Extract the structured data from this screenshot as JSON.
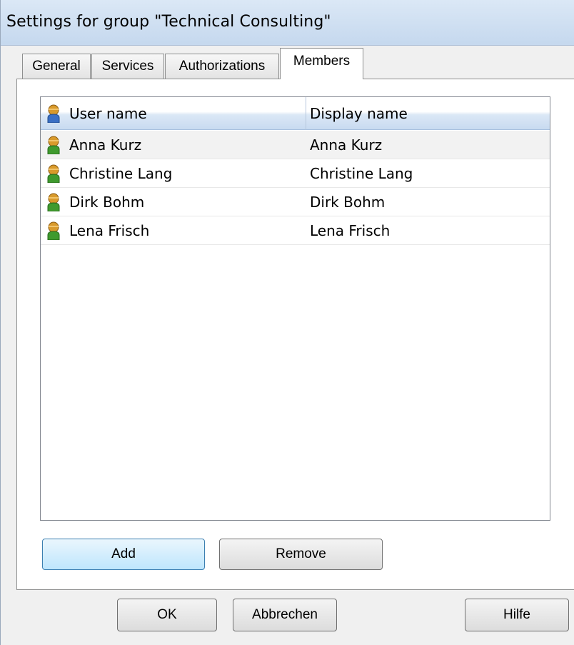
{
  "window": {
    "title": "Settings for group \"Technical Consulting\""
  },
  "tabs": [
    {
      "label": "General",
      "active": false
    },
    {
      "label": "Services",
      "active": false
    },
    {
      "label": "Authorizations",
      "active": false
    },
    {
      "label": "Members",
      "active": true
    }
  ],
  "members_list": {
    "columns": [
      "User name",
      "Display name"
    ],
    "rows": [
      {
        "user_name": "Anna Kurz",
        "display_name": "Anna Kurz",
        "selected": true
      },
      {
        "user_name": "Christine Lang",
        "display_name": "Christine Lang",
        "selected": false
      },
      {
        "user_name": "Dirk Bohm",
        "display_name": "Dirk Bohm",
        "selected": false
      },
      {
        "user_name": "Lena Frisch",
        "display_name": "Lena Frisch",
        "selected": false
      }
    ]
  },
  "buttons": {
    "add": "Add",
    "remove": "Remove",
    "ok": "OK",
    "cancel": "Abbrechen",
    "help": "Hilfe"
  },
  "icons": {
    "header_user": "user-icon",
    "member_user": "user-icon"
  },
  "colors": {
    "header_gradient": "#c8daf0",
    "default_button_border": "#3c7fb1",
    "user_icon_head": "#d99a2b",
    "user_icon_body_header": "#3a6fc4",
    "user_icon_body_member": "#3f9a2e"
  }
}
